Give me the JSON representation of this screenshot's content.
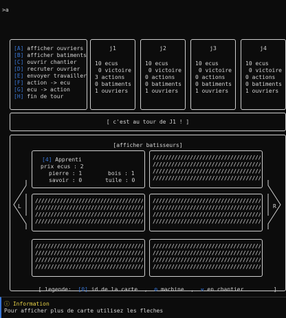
{
  "prompt": ">a",
  "menu": {
    "items": [
      {
        "key": "[A]",
        "label": "afficher ouvriers"
      },
      {
        "key": "[B]",
        "label": "afficher batiments"
      },
      {
        "key": "[C]",
        "label": "ouvrir chantier"
      },
      {
        "key": "[D]",
        "label": "recruter ouvrier"
      },
      {
        "key": "[E]",
        "label": "envoyer travailler"
      },
      {
        "key": "[F]",
        "label": "action -> ecu"
      },
      {
        "key": "[G]",
        "label": "ecu -> action"
      },
      {
        "key": "[H]",
        "label": "fin de tour"
      }
    ]
  },
  "players": [
    {
      "name": "j1",
      "ecus": "10 ecus",
      "victoire": " 0 victoire",
      "actions": "3 actions",
      "batiments": "0 batiments",
      "ouvriers": "1 ouvriers"
    },
    {
      "name": "j2",
      "ecus": "10 ecus",
      "victoire": " 0 victoire",
      "actions": "0 actions",
      "batiments": "0 batiments",
      "ouvriers": "1 ouvriers"
    },
    {
      "name": "j3",
      "ecus": "10 ecus",
      "victoire": " 0 victoire",
      "actions": "0 actions",
      "batiments": "0 batiments",
      "ouvriers": "1 ouvriers"
    },
    {
      "name": "j4",
      "ecus": "10 ecus",
      "victoire": " 0 victoire",
      "actions": "0 actions",
      "batiments": "0 batiments",
      "ouvriers": "1 ouvriers"
    }
  ],
  "turn_banner": "[ c'est au tour de J1 ! ]",
  "builders_header": "[afficher batisseurs]",
  "card": {
    "id": "[4]",
    "name": "Apprenti",
    "prix": "prix ecus : 2",
    "pierre": "pierre : 1",
    "bois": "bois : 1",
    "savoir": "savoir : 0",
    "tuile": "tuile : 0"
  },
  "nav": {
    "left": "L",
    "right": "R"
  },
  "legend": {
    "open": "[ legende:",
    "id_marker": "[0]",
    "id_label": "id de la carte",
    "sep1": ",",
    "machine_marker": "⚙",
    "machine_label": "machine",
    "sep2": ",",
    "chantier_marker": "⚒",
    "chantier_label": "en chantier",
    "close": "]"
  },
  "hatch_line": "//////////////////////////////////////",
  "info": {
    "title": "Information",
    "text": "Pour afficher plus de carte utilisez les fleches"
  },
  "colors": {
    "accent": "#3a78d8",
    "info_title": "#e7d247"
  }
}
